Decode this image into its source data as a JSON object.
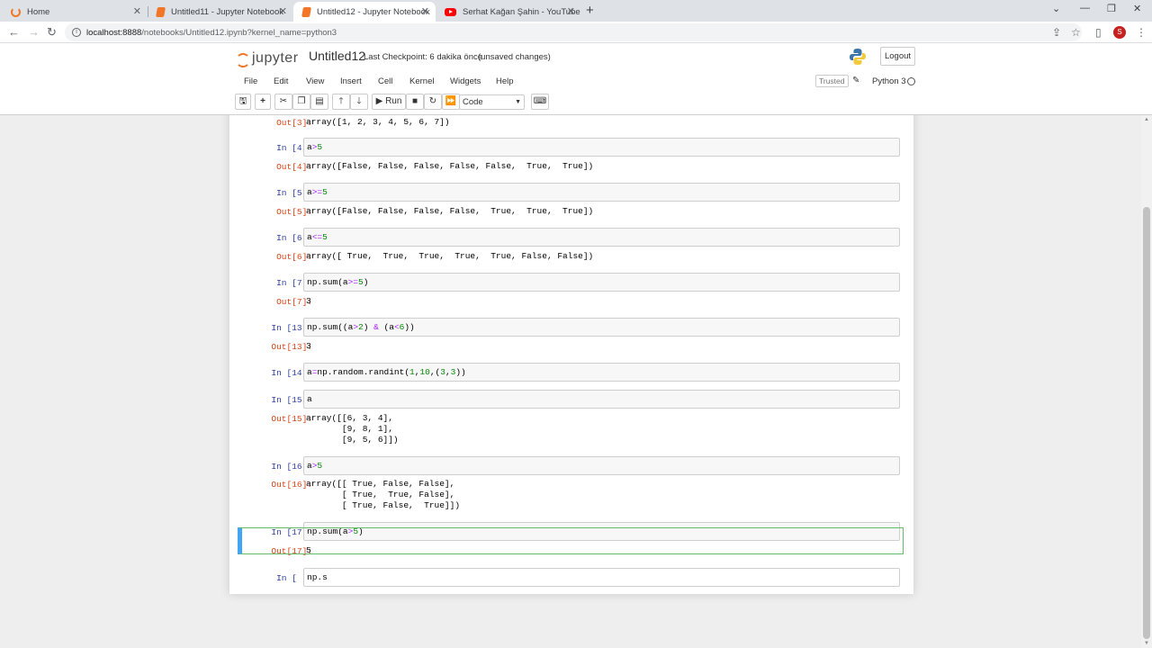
{
  "browser": {
    "tabs": [
      {
        "title": "Home",
        "icon": "jupyter-icon",
        "active": false
      },
      {
        "title": "Untitled11 - Jupyter Notebook",
        "icon": "notebook-icon",
        "active": false
      },
      {
        "title": "Untitled12 - Jupyter Notebook",
        "icon": "notebook-icon",
        "active": true
      },
      {
        "title": "Serhat Kağan Şahin - YouTube",
        "icon": "youtube-icon",
        "active": false
      }
    ],
    "url_host": "localhost:8888",
    "url_path": "/notebooks/Untitled12.ipynb?kernel_name=python3",
    "profile_initial": "S"
  },
  "jupyter": {
    "logo_text": "jupyter",
    "notebook_name": "Untitled12",
    "checkpoint": "Last Checkpoint: 6 dakika önce",
    "unsaved": "(unsaved changes)",
    "logout_label": "Logout",
    "menu": [
      "File",
      "Edit",
      "View",
      "Insert",
      "Cell",
      "Kernel",
      "Widgets",
      "Help"
    ],
    "trusted": "Trusted",
    "kernel_name": "Python 3",
    "toolbar": {
      "run_label": "Run",
      "cell_type": "Code"
    }
  },
  "cells": [
    {
      "kind": "out",
      "prompt": "Out[3]:",
      "lines": [
        "array([1, 2, 3, 4, 5, 6, 7])"
      ]
    },
    {
      "kind": "in",
      "prompt": "In [4]:",
      "code": "a>5"
    },
    {
      "kind": "out",
      "prompt": "Out[4]:",
      "lines": [
        "array([False, False, False, False, False,  True,  True])"
      ]
    },
    {
      "kind": "in",
      "prompt": "In [5]:",
      "code": "a>=5"
    },
    {
      "kind": "out",
      "prompt": "Out[5]:",
      "lines": [
        "array([False, False, False, False,  True,  True,  True])"
      ]
    },
    {
      "kind": "in",
      "prompt": "In [6]:",
      "code": "a<=5"
    },
    {
      "kind": "out",
      "prompt": "Out[6]:",
      "lines": [
        "array([ True,  True,  True,  True,  True, False, False])"
      ]
    },
    {
      "kind": "in",
      "prompt": "In [7]:",
      "code": "np.sum(a>=5)"
    },
    {
      "kind": "out",
      "prompt": "Out[7]:",
      "lines": [
        "3"
      ]
    },
    {
      "kind": "in",
      "prompt": "In [13]:",
      "code": "np.sum((a>2) & (a<6))"
    },
    {
      "kind": "out",
      "prompt": "Out[13]:",
      "lines": [
        "3"
      ]
    },
    {
      "kind": "in",
      "prompt": "In [14]:",
      "code": "a=np.random.randint(1,10,(3,3))"
    },
    {
      "kind": "in",
      "prompt": "In [15]:",
      "code": "a"
    },
    {
      "kind": "out",
      "prompt": "Out[15]:",
      "lines": [
        "array([[6, 3, 4],",
        "       [9, 8, 1],",
        "       [9, 5, 6]])"
      ]
    },
    {
      "kind": "in",
      "prompt": "In [16]:",
      "code": "a>5"
    },
    {
      "kind": "out",
      "prompt": "Out[16]:",
      "lines": [
        "array([[ True, False, False],",
        "       [ True,  True, False],",
        "       [ True, False,  True]])"
      ]
    },
    {
      "kind": "in",
      "prompt": "In [17]:",
      "code": "np.sum(a>5)"
    },
    {
      "kind": "out",
      "prompt": "Out[17]:",
      "lines": [
        "5"
      ]
    },
    {
      "kind": "in",
      "prompt": "In [ ]:",
      "code": "np.s",
      "active": true
    }
  ]
}
